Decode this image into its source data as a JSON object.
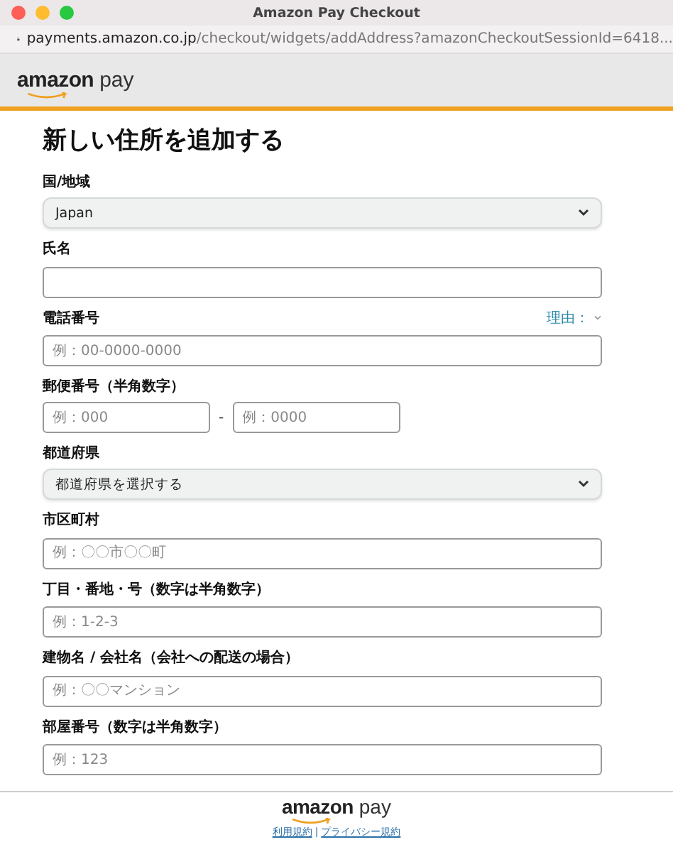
{
  "window": {
    "title": "Amazon Pay Checkout"
  },
  "address_bar": {
    "domain": "payments.amazon.co.jp",
    "path": "/checkout/widgets/addAddress?amazonCheckoutSessionId=6418..."
  },
  "header": {
    "logo_word": "amazon",
    "logo_suffix": "pay"
  },
  "heading": "新しい住所を追加する",
  "fields": [
    {
      "kind": "select",
      "label": "国/地域",
      "value": "Japan"
    },
    {
      "kind": "text",
      "label": "氏名"
    },
    {
      "kind": "text",
      "label": "電話番号",
      "placeholder": "例：00-0000-0000",
      "aside": "理由："
    },
    {
      "kind": "split",
      "label": "郵便番号（半角数字）",
      "parts": [
        {
          "placeholder": "例：000"
        },
        {
          "placeholder": "例：0000"
        }
      ],
      "separator": "-"
    },
    {
      "kind": "select",
      "label": "都道府県",
      "value": "都道府県を選択する"
    },
    {
      "kind": "text",
      "label": "市区町村",
      "placeholder": "例：〇〇市〇〇町"
    },
    {
      "kind": "text",
      "label": "丁目・番地・号（数字は半角数字）",
      "placeholder": "例：1-2-3"
    },
    {
      "kind": "text",
      "label": "建物名 / 会社名（会社への配送の場合）",
      "placeholder": "例：〇〇マンション"
    },
    {
      "kind": "text",
      "label": "部屋番号（数字は半角数字）",
      "placeholder": "例：123"
    }
  ],
  "footer": {
    "logo_word": "amazon",
    "logo_suffix": "pay",
    "links": [
      "利用規約",
      "プライバシー規約"
    ],
    "separator": "|"
  }
}
